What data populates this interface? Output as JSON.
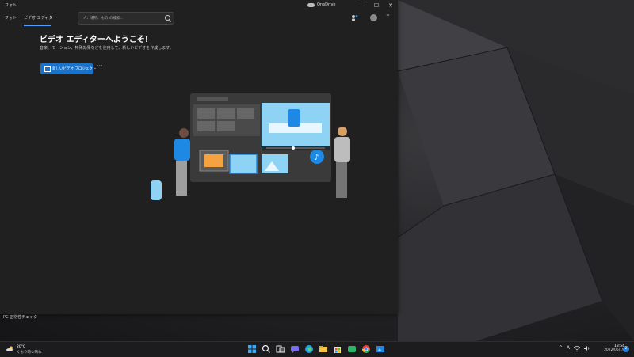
{
  "window": {
    "app_title": "フォト",
    "onedrive_label": "OneDrive",
    "controls": {
      "minimize": "—",
      "maximize": "☐",
      "close": "✕"
    }
  },
  "toolbar": {
    "tabs": [
      {
        "label": "フォト"
      },
      {
        "label": "ビデオ エディター"
      }
    ],
    "search_placeholder": "人、場所、もの の検索...",
    "more_label": "···"
  },
  "main": {
    "title": "ビデオ エディターへようこそ!",
    "subtitle": "音楽、モーション、特殊効果などを使用して、新しいビデオを作成します。",
    "new_project_label": "新しいビデオ プロジェクト",
    "more_label": "···"
  },
  "desktop": {
    "label": "PC 正常性チェック"
  },
  "taskbar": {
    "weather_temp": "20°C",
    "weather_desc": "くもり時々晴れ",
    "tray_ime": "A",
    "clock_time": "18:54",
    "clock_date": "2022/05/19",
    "notif_count": "2"
  },
  "colors": {
    "accent": "#1a73c8",
    "window_bg": "#202020",
    "taskbar_bg": "#1c1c1e"
  },
  "icons": [
    "search-icon",
    "cloud-icon",
    "people-icon",
    "avatar-icon",
    "film-icon",
    "weather-icon",
    "windows-start-icon",
    "wifi-icon",
    "speaker-icon"
  ]
}
